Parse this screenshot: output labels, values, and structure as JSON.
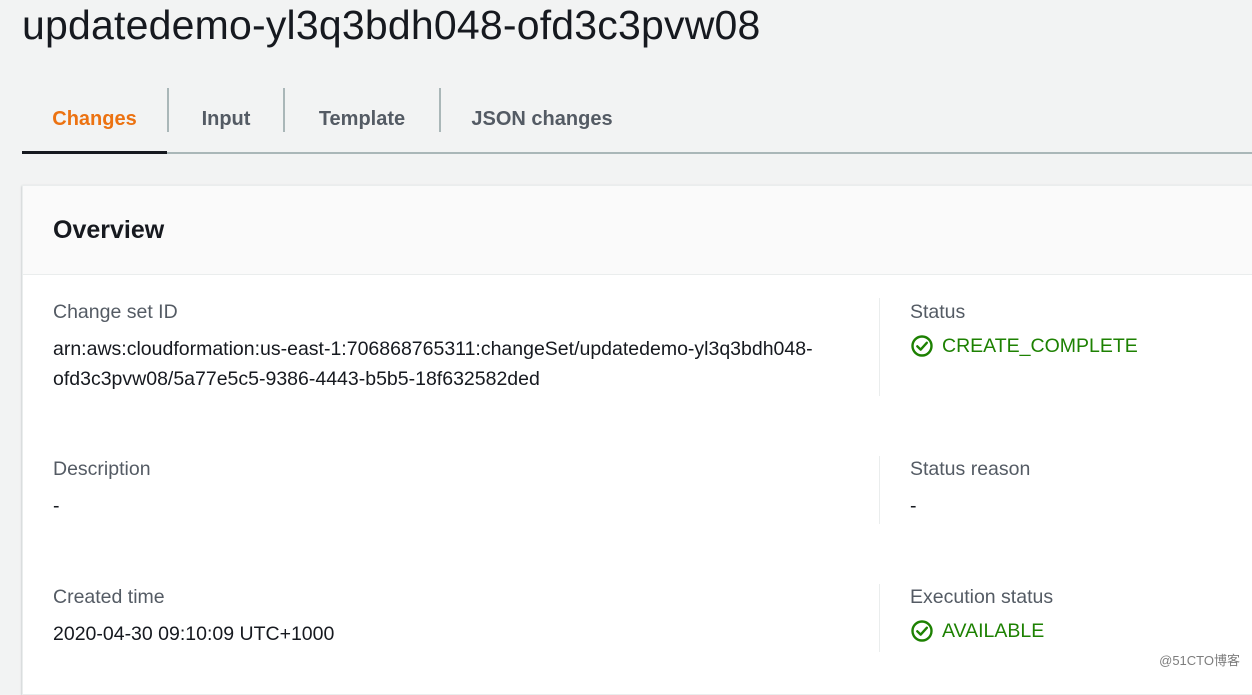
{
  "page": {
    "title": "updatedemo-yl3q3bdh048-ofd3c3pvw08"
  },
  "tabs": [
    {
      "label": "Changes",
      "active": true
    },
    {
      "label": "Input"
    },
    {
      "label": "Template"
    },
    {
      "label": "JSON changes"
    }
  ],
  "overview": {
    "title": "Overview",
    "change_set_id": {
      "label": "Change set ID",
      "value": "arn:aws:cloudformation:us-east-1:706868765311:changeSet/updatedemo-yl3q3bdh048-ofd3c3pvw08/5a77e5c5-9386-4443-b5b5-18f632582ded"
    },
    "status": {
      "label": "Status",
      "value": "CREATE_COMPLETE",
      "icon": "check-circle-icon",
      "color": "#1d8102"
    },
    "description": {
      "label": "Description",
      "value": "-"
    },
    "status_reason": {
      "label": "Status reason",
      "value": "-"
    },
    "created_time": {
      "label": "Created time",
      "value": "2020-04-30 09:10:09 UTC+1000"
    },
    "execution_status": {
      "label": "Execution status",
      "value": "AVAILABLE",
      "icon": "check-circle-icon",
      "color": "#1d8102"
    }
  },
  "watermark": "@51CTO博客",
  "colors": {
    "accent": "#ec7211",
    "success": "#1d8102",
    "label": "#545b64"
  }
}
